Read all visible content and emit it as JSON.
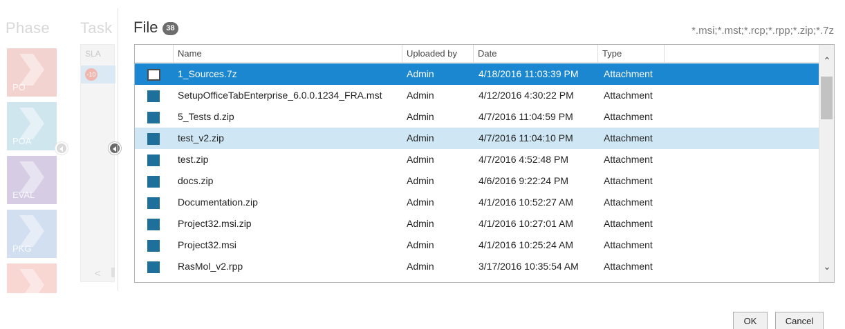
{
  "background": {
    "phase_header": "Phase",
    "task_header": "Task",
    "phases": [
      {
        "label": "PO",
        "color": "#f3d3cf"
      },
      {
        "label": "POA",
        "color": "#cfe6ef"
      },
      {
        "label": "EVAL",
        "color": "#d6cde4"
      },
      {
        "label": "PKG",
        "color": "#d2dff0"
      },
      {
        "label": "",
        "color": "#f8d6d2"
      }
    ],
    "task_sla_label": "SLA",
    "task_badge": "-10"
  },
  "dialog": {
    "title": "File",
    "count": "38",
    "filter": "*.msi;*.mst;*.rcp;*.rpp;*.zip;*.7z",
    "columns": [
      "Name",
      "Uploaded by",
      "Date",
      "Type"
    ],
    "rows": [
      {
        "name": "1_Sources.7z",
        "uploaded_by": "Admin",
        "date": "4/18/2016 11:03:39 PM",
        "type": "Attachment",
        "state": "selected"
      },
      {
        "name": "SetupOfficeTabEnterprise_6.0.0.1234_FRA.mst",
        "uploaded_by": "Admin",
        "date": "4/12/2016 4:30:22 PM",
        "type": "Attachment",
        "state": ""
      },
      {
        "name": "5_Tests d.zip",
        "uploaded_by": "Admin",
        "date": "4/7/2016 11:04:59 PM",
        "type": "Attachment",
        "state": ""
      },
      {
        "name": "test_v2.zip",
        "uploaded_by": "Admin",
        "date": "4/7/2016 11:04:10 PM",
        "type": "Attachment",
        "state": "hover"
      },
      {
        "name": "test.zip",
        "uploaded_by": "Admin",
        "date": "4/7/2016 4:52:48 PM",
        "type": "Attachment",
        "state": ""
      },
      {
        "name": "docs.zip",
        "uploaded_by": "Admin",
        "date": "4/6/2016 9:22:24 PM",
        "type": "Attachment",
        "state": ""
      },
      {
        "name": "Documentation.zip",
        "uploaded_by": "Admin",
        "date": "4/1/2016 10:52:27 AM",
        "type": "Attachment",
        "state": ""
      },
      {
        "name": "Project32.msi.zip",
        "uploaded_by": "Admin",
        "date": "4/1/2016 10:27:01 AM",
        "type": "Attachment",
        "state": ""
      },
      {
        "name": "Project32.msi",
        "uploaded_by": "Admin",
        "date": "4/1/2016 10:25:24 AM",
        "type": "Attachment",
        "state": ""
      },
      {
        "name": "RasMol_v2.rpp",
        "uploaded_by": "Admin",
        "date": "3/17/2016 10:35:54 AM",
        "type": "Attachment",
        "state": ""
      }
    ],
    "ok_label": "OK",
    "cancel_label": "Cancel",
    "accent_color": "#1a87d0",
    "file_icon_color": "#1e6f99"
  }
}
